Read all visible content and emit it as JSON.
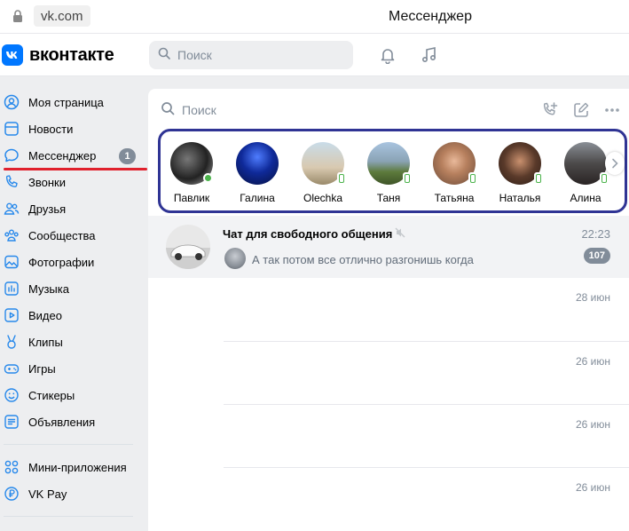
{
  "browser": {
    "url": "vk.com",
    "title": "Мессенджер"
  },
  "header": {
    "logo_text": "вконтакте",
    "search_placeholder": "Поиск"
  },
  "sidebar": {
    "items": [
      {
        "label": "Моя страница",
        "icon": "user-circle-icon"
      },
      {
        "label": "Новости",
        "icon": "news-icon"
      },
      {
        "label": "Мессенджер",
        "icon": "message-bubble-icon",
        "badge": "1"
      },
      {
        "label": "Звонки",
        "icon": "phone-icon"
      },
      {
        "label": "Друзья",
        "icon": "friends-icon"
      },
      {
        "label": "Сообщества",
        "icon": "communities-icon"
      },
      {
        "label": "Фотографии",
        "icon": "photo-icon"
      },
      {
        "label": "Музыка",
        "icon": "music-bars-icon"
      },
      {
        "label": "Видео",
        "icon": "video-icon"
      },
      {
        "label": "Клипы",
        "icon": "clips-icon"
      },
      {
        "label": "Игры",
        "icon": "gamepad-icon"
      },
      {
        "label": "Стикеры",
        "icon": "smile-icon"
      },
      {
        "label": "Объявления",
        "icon": "ads-icon"
      }
    ],
    "extra": [
      {
        "label": "Мини-приложения",
        "icon": "mini-apps-icon"
      },
      {
        "label": "VK Pay",
        "icon": "vk-pay-icon"
      }
    ]
  },
  "messenger": {
    "search_placeholder": "Поиск",
    "contacts": [
      {
        "name": "Павлик",
        "status": "online"
      },
      {
        "name": "Галина",
        "status": "none"
      },
      {
        "name": "Olechka",
        "status": "mobile"
      },
      {
        "name": "Таня",
        "status": "mobile"
      },
      {
        "name": "Татьяна",
        "status": "mobile"
      },
      {
        "name": "Наталья",
        "status": "mobile"
      },
      {
        "name": "Алина",
        "status": "mobile"
      }
    ],
    "chat": {
      "title": "Чат для свободного общения",
      "time": "22:23",
      "preview": "А так потом все отлично разгонишь когда",
      "unread": "107"
    },
    "dates": [
      "28 июн",
      "26 июн",
      "26 июн",
      "26 июн"
    ]
  },
  "colors": {
    "accent": "#0077ff",
    "highlight_frame": "#2f3494",
    "underline": "#e0212d",
    "online": "#4bb34b"
  }
}
